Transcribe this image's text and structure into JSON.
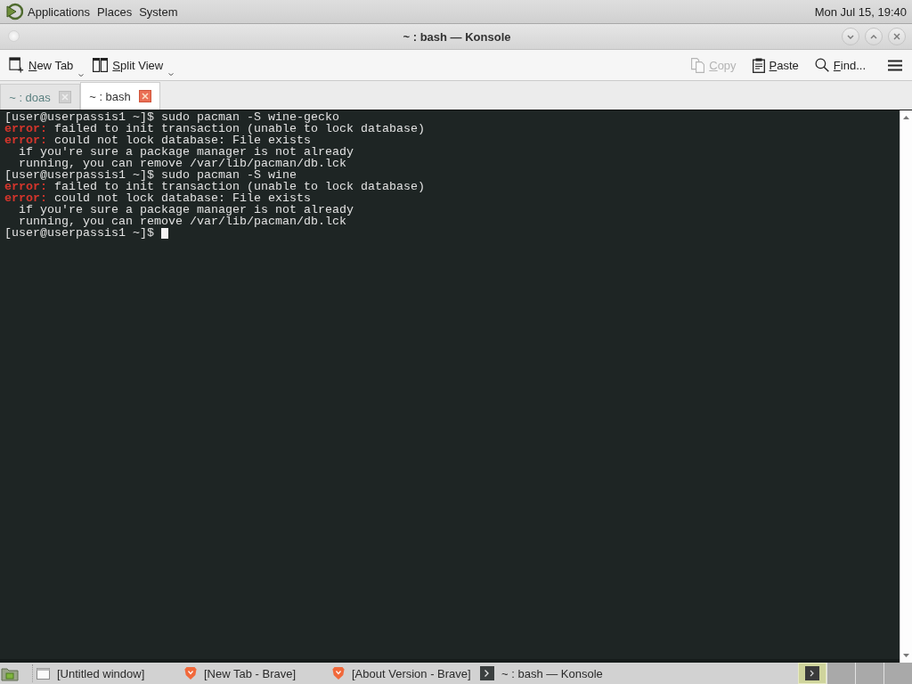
{
  "top_panel": {
    "menus": [
      {
        "label": "Applications"
      },
      {
        "label": "Places"
      },
      {
        "label": "System"
      }
    ],
    "clock": "Mon Jul 15, 19:40"
  },
  "window": {
    "title": "~ : bash — Konsole"
  },
  "toolbar": {
    "left": [
      {
        "kind": "new-tab",
        "label": "New Tab",
        "disabled": false,
        "dropdown": true
      },
      {
        "kind": "split-view",
        "label": "Split View",
        "disabled": false,
        "dropdown": true
      }
    ],
    "right": [
      {
        "kind": "copy",
        "label": "Copy",
        "disabled": true,
        "dropdown": false
      },
      {
        "kind": "paste",
        "label": "Paste",
        "disabled": false,
        "dropdown": false
      },
      {
        "kind": "find",
        "label": "Find...",
        "disabled": false,
        "dropdown": false
      }
    ]
  },
  "tabs": [
    {
      "label": "~ : doas",
      "selected": false
    },
    {
      "label": "~ : bash",
      "selected": true
    }
  ],
  "terminal": {
    "lines": [
      {
        "kind": "prompt",
        "prompt": "[user@userpassis1 ~]$",
        "command": "sudo pacman -S wine-gecko"
      },
      {
        "kind": "error",
        "prefix": "error:",
        "text": "failed to init transaction (unable to lock database)"
      },
      {
        "kind": "error",
        "prefix": "error:",
        "text": "could not lock database: File exists"
      },
      {
        "kind": "detail",
        "text": "if you're sure a package manager is not already"
      },
      {
        "kind": "detail",
        "text": "running, you can remove /var/lib/pacman/db.lck"
      },
      {
        "kind": "prompt",
        "prompt": "[user@userpassis1 ~]$",
        "command": "sudo pacman -S wine"
      },
      {
        "kind": "error",
        "prefix": "error:",
        "text": "failed to init transaction (unable to lock database)"
      },
      {
        "kind": "error",
        "prefix": "error:",
        "text": "could not lock database: File exists"
      },
      {
        "kind": "detail",
        "text": "if you're sure a package manager is not already"
      },
      {
        "kind": "detail",
        "text": "running, you can remove /var/lib/pacman/db.lck"
      },
      {
        "kind": "prompt",
        "prompt": "[user@userpassis1 ~]$"
      }
    ],
    "cursor": true
  },
  "taskbar": {
    "tasks": [
      {
        "kind": "window",
        "label": "[Untitled window]"
      },
      {
        "kind": "browser",
        "label": "[New Tab - Brave]"
      },
      {
        "kind": "browser",
        "label": "[About Version - Brave]"
      },
      {
        "kind": "terminal",
        "label": "~ : bash — Konsole"
      }
    ],
    "workspaces": [
      {
        "selected": true,
        "windows": [
          {
            "kind": "terminal"
          }
        ]
      },
      {
        "selected": false
      },
      {
        "selected": false
      },
      {
        "selected": false
      }
    ]
  }
}
